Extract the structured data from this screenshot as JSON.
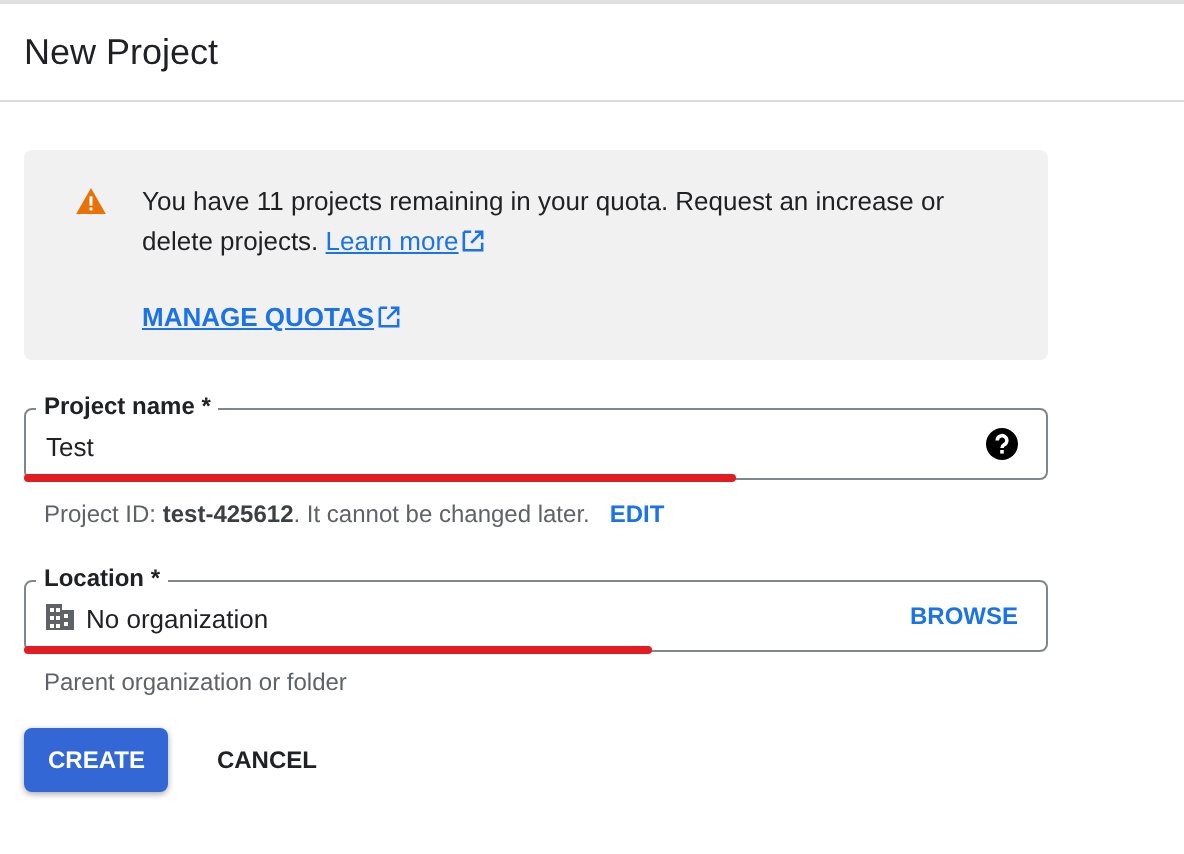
{
  "header": {
    "title": "New Project"
  },
  "notice": {
    "text": "You have 11 projects remaining in your quota. Request an increase or delete projects.",
    "link": "Learn more",
    "action": "MANAGE QUOTAS"
  },
  "fields": [
    {
      "kind": "text",
      "label": "Project name *",
      "value": "Test",
      "helper": "Project ID: **test-425612**. It cannot be changed later.",
      "helper_action": "EDIT",
      "annotated": true
    },
    {
      "kind": "picker",
      "label": "Location *",
      "value": "No organization",
      "action": "BROWSE",
      "helper": "Parent organization or folder",
      "annotated": true
    }
  ],
  "buttons": [
    {
      "label": "CREATE",
      "kind": "primary"
    },
    {
      "label": "CANCEL",
      "kind": "text"
    }
  ]
}
